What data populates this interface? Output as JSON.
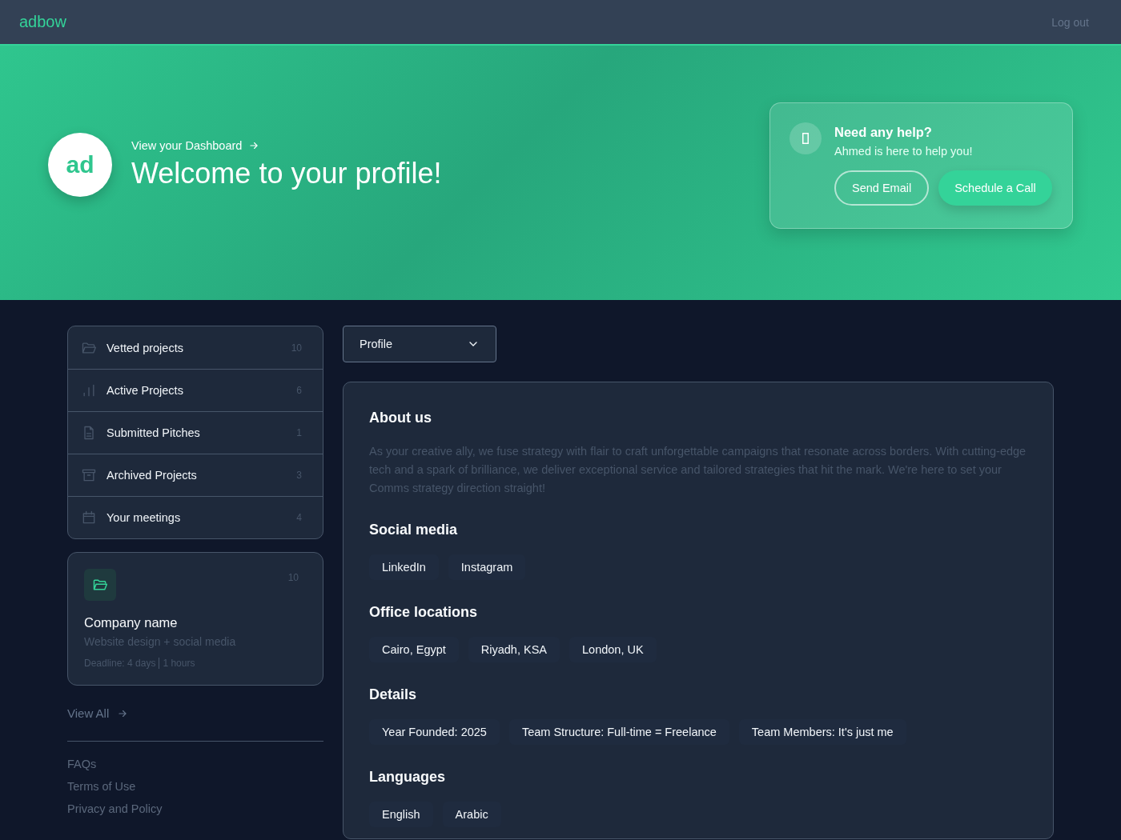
{
  "header": {
    "logo": "adbow",
    "logout": "Log out"
  },
  "hero": {
    "avatar": "ad",
    "dashboard_link": "View your Dashboard",
    "title": "Welcome to your profile!",
    "help": {
      "title": "Need any help?",
      "subtitle": "Ahmed is here to help you!",
      "buttons": [
        {
          "label": "Send Email",
          "kind": "outline"
        },
        {
          "label": "Schedule a Call",
          "kind": "solid"
        }
      ]
    }
  },
  "sidebar": {
    "items": [
      {
        "label": "Vetted projects",
        "count": "10",
        "kind": "folder"
      },
      {
        "label": "Active Projects",
        "count": "6",
        "kind": "chart"
      },
      {
        "label": "Submitted Pitches",
        "count": "1",
        "kind": "file"
      },
      {
        "label": "Archived Projects",
        "count": "3",
        "kind": "archive"
      },
      {
        "label": "Your meetings",
        "count": "4",
        "kind": "calendar"
      }
    ],
    "project_card": {
      "count": "10",
      "title": "Company name",
      "subtitle": "Website design + social media",
      "deadline_days": "Deadline: 4 days",
      "deadline_hours": "1 hours"
    },
    "view_all": "View All",
    "footer_links": [
      "FAQs",
      "Terms of Use",
      "Privacy and Policy"
    ]
  },
  "dropdown": {
    "value": "Profile"
  },
  "profile": {
    "sections": [
      {
        "title": "About us",
        "kind": "text",
        "text": "As your creative ally, we fuse strategy with flair to craft unforgettable campaigns that resonate across borders. With cutting-edge tech and a spark of brilliance, we deliver exceptional service and tailored strategies that hit the mark. We're here to set your Comms strategy direction straight!"
      },
      {
        "title": "Social media",
        "kind": "chips",
        "items": [
          "LinkedIn",
          "Instagram"
        ]
      },
      {
        "title": "Office locations",
        "kind": "chips",
        "items": [
          "Cairo, Egypt",
          "Riyadh, KSA",
          "London, UK"
        ]
      },
      {
        "title": "Details",
        "kind": "chips",
        "items": [
          "Year Founded: 2025",
          "Team Structure: Full-time = Freelance",
          "Team Members: It's just me"
        ]
      },
      {
        "title": "Languages",
        "kind": "chips",
        "items": [
          "English",
          "Arabic"
        ]
      }
    ]
  }
}
